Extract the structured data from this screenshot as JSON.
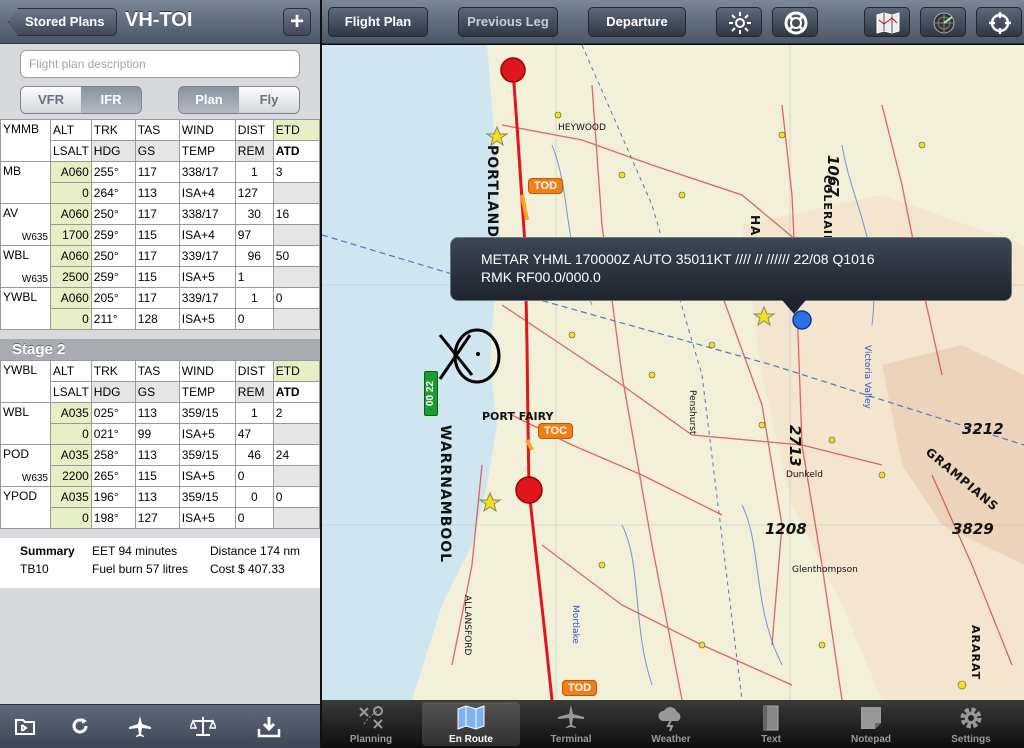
{
  "left_nav": {
    "back_label": "Stored Plans",
    "title": "VH-TOI",
    "add_label": "+"
  },
  "description": {
    "placeholder": "Flight plan description"
  },
  "rules_segment": {
    "vfr": "VFR",
    "ifr": "IFR",
    "selected": "IFR"
  },
  "mode_segment": {
    "plan": "Plan",
    "fly": "Fly",
    "selected": "Plan"
  },
  "stage1": {
    "header": {
      "origin": "YMMB",
      "alt": "ALT",
      "trk": "TRK",
      "tas": "TAS",
      "wind": "WIND",
      "dist": "DIST",
      "etd": "ETD",
      "lsalt": "LSALT",
      "hdg": "HDG",
      "gs": "GS",
      "temp": "TEMP",
      "rem": "REM",
      "atd": "ATD"
    },
    "legs": [
      {
        "wp": "MB",
        "via": "",
        "alt": "A060",
        "trk": "255°",
        "tas": "117",
        "wind": "338/17",
        "dist": "1",
        "etd": "3",
        "lsalt": "0",
        "hdg": "264°",
        "gs": "113",
        "temp": "ISA+4",
        "rem": "127",
        "atd": ""
      },
      {
        "wp": "AV",
        "via": "W635",
        "alt": "A060",
        "trk": "250°",
        "tas": "117",
        "wind": "338/17",
        "dist": "30",
        "etd": "16",
        "lsalt": "1700",
        "hdg": "259°",
        "gs": "115",
        "temp": "ISA+4",
        "rem": "97",
        "atd": ""
      },
      {
        "wp": "WBL",
        "via": "W635",
        "alt": "A060",
        "trk": "250°",
        "tas": "117",
        "wind": "339/17",
        "dist": "96",
        "etd": "50",
        "lsalt": "2500",
        "hdg": "259°",
        "gs": "115",
        "temp": "ISA+5",
        "rem": "1",
        "atd": ""
      },
      {
        "wp": "YWBL",
        "via": "",
        "alt": "A060",
        "trk": "205°",
        "tas": "117",
        "wind": "339/17",
        "dist": "1",
        "etd": "0",
        "lsalt": "0",
        "hdg": "211°",
        "gs": "128",
        "temp": "ISA+5",
        "rem": "0",
        "atd": ""
      }
    ]
  },
  "stage2": {
    "title": "Stage 2",
    "header": {
      "origin": "YWBL",
      "alt": "ALT",
      "trk": "TRK",
      "tas": "TAS",
      "wind": "WIND",
      "dist": "DIST",
      "etd": "ETD",
      "lsalt": "LSALT",
      "hdg": "HDG",
      "gs": "GS",
      "temp": "TEMP",
      "rem": "REM",
      "atd": "ATD"
    },
    "legs": [
      {
        "wp": "WBL",
        "via": "",
        "alt": "A035",
        "trk": "025°",
        "tas": "113",
        "wind": "359/15",
        "dist": "1",
        "etd": "2",
        "lsalt": "0",
        "hdg": "021°",
        "gs": "99",
        "temp": "ISA+5",
        "rem": "47",
        "atd": ""
      },
      {
        "wp": "POD",
        "via": "W635",
        "alt": "A035",
        "trk": "258°",
        "tas": "113",
        "wind": "359/15",
        "dist": "46",
        "etd": "24",
        "lsalt": "2200",
        "hdg": "265°",
        "gs": "115",
        "temp": "ISA+5",
        "rem": "0",
        "atd": ""
      },
      {
        "wp": "YPOD",
        "via": "",
        "alt": "A035",
        "trk": "196°",
        "tas": "113",
        "wind": "359/15",
        "dist": "0",
        "etd": "0",
        "lsalt": "0",
        "hdg": "198°",
        "gs": "127",
        "temp": "ISA+5",
        "rem": "0",
        "atd": ""
      }
    ]
  },
  "summary": {
    "label": "Summary",
    "aircraft": "TB10",
    "eet": "EET 94 minutes",
    "fuel": "Fuel burn 57 litres",
    "distance": "Distance 174 nm",
    "cost": "Cost $ 407.33"
  },
  "left_toolbar": {
    "icons": [
      "folder-icon",
      "refresh-icon",
      "airplane-icon",
      "balance-scale-icon",
      "download-tray-icon"
    ]
  },
  "right_nav": {
    "flight_plan": "Flight Plan",
    "previous_leg": "Previous Leg",
    "departure": "Departure",
    "icons": [
      "brightness-icon",
      "lifebuoy-icon",
      "map-layers-icon",
      "radar-icon",
      "locate-icon"
    ]
  },
  "metar_popup": {
    "line1": "METAR YHML 170000Z AUTO 35011KT //// // ////// 22/08 Q1016",
    "line2": "RMK RF00.0/000.0"
  },
  "map": {
    "tags": {
      "tod_top": "TOD",
      "toc": "TOC",
      "tod_bottom": "TOD"
    },
    "badge": "00 22",
    "towns": [
      "PORTLAND",
      "WARRNAMBOOL",
      "PORT FAIRY",
      "HAMILTON",
      "COLERAINE",
      "GRAMPIANS",
      "HEYWOOD",
      "ALLANSFORD",
      "ARARAT",
      "Dunkeld",
      "Victoria Valley",
      "Glenthompson",
      "Mortlake",
      "Penshurst"
    ],
    "spot_heights": [
      "1067",
      "2713",
      "1208",
      "3212",
      "3829"
    ]
  },
  "tabbar": {
    "tabs": [
      {
        "label": "Planning",
        "icon": "planning-icon"
      },
      {
        "label": "En Route",
        "icon": "map-icon"
      },
      {
        "label": "Terminal",
        "icon": "airplane-icon"
      },
      {
        "label": "Weather",
        "icon": "cloud-lightning-icon"
      },
      {
        "label": "Text",
        "icon": "book-icon"
      },
      {
        "label": "Notepad",
        "icon": "notepad-icon"
      },
      {
        "label": "Settings",
        "icon": "gear-icon"
      }
    ],
    "active": "En Route"
  }
}
